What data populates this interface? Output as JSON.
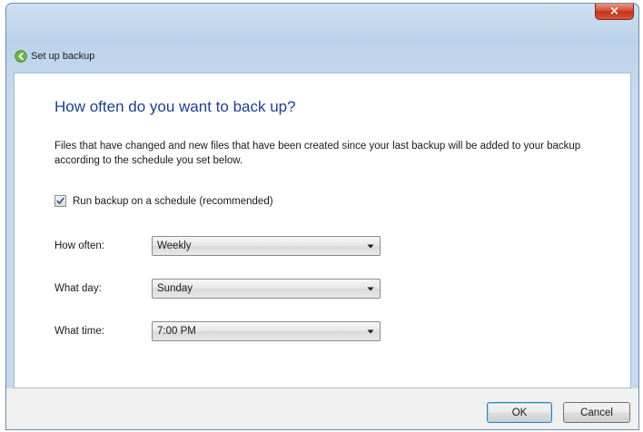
{
  "window": {
    "title": "Set up backup",
    "close_glyph": "×"
  },
  "main": {
    "heading": "How often do you want to back up?",
    "description": "Files that have changed and new files that have been created since your last backup will be added to your backup according to the schedule you set below.",
    "schedule_checkbox": {
      "label": "Run backup on a schedule (recommended)",
      "checked": true
    },
    "fields": {
      "how_often": {
        "label": "How often:",
        "value": "Weekly"
      },
      "what_day": {
        "label": "What day:",
        "value": "Sunday"
      },
      "what_time": {
        "label": "What time:",
        "value": "7:00 PM"
      }
    }
  },
  "footer": {
    "ok_label": "OK",
    "cancel_label": "Cancel"
  },
  "colors": {
    "heading": "#1b3f8f",
    "close_button": "#d9533b",
    "frame": "#bcd2ea",
    "footer": "#f0f0f0"
  },
  "icons": {
    "back": "back-arrow-icon",
    "close": "close-icon",
    "check": "checkmark-icon",
    "dropdown": "chevron-down-icon"
  }
}
